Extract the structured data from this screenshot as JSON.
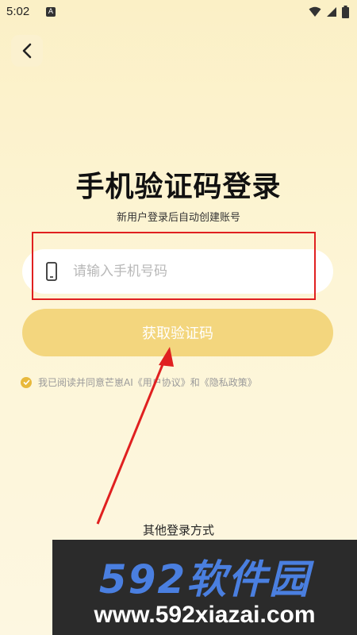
{
  "status_bar": {
    "time": "5:02",
    "notif_letter": "A"
  },
  "header": {
    "title": "手机验证码登录",
    "subtitle": "新用户登录后自动创建账号"
  },
  "phone_field": {
    "placeholder": "请输入手机号码",
    "value": ""
  },
  "get_code_button": {
    "label": "获取验证码"
  },
  "agreement": {
    "prefix": "我已阅读并同意芒崽AI",
    "user_agreement": "《用户协议》",
    "and": "和",
    "privacy_policy": "《隐私政策》",
    "checked": true
  },
  "other_login": {
    "label": "其他登录方式"
  },
  "watermark": {
    "brand": "592软件园",
    "url": "www.592xiazai.com"
  },
  "colors": {
    "accent": "#f3d67e",
    "check": "#e8b93c",
    "annotation": "#e02020"
  }
}
